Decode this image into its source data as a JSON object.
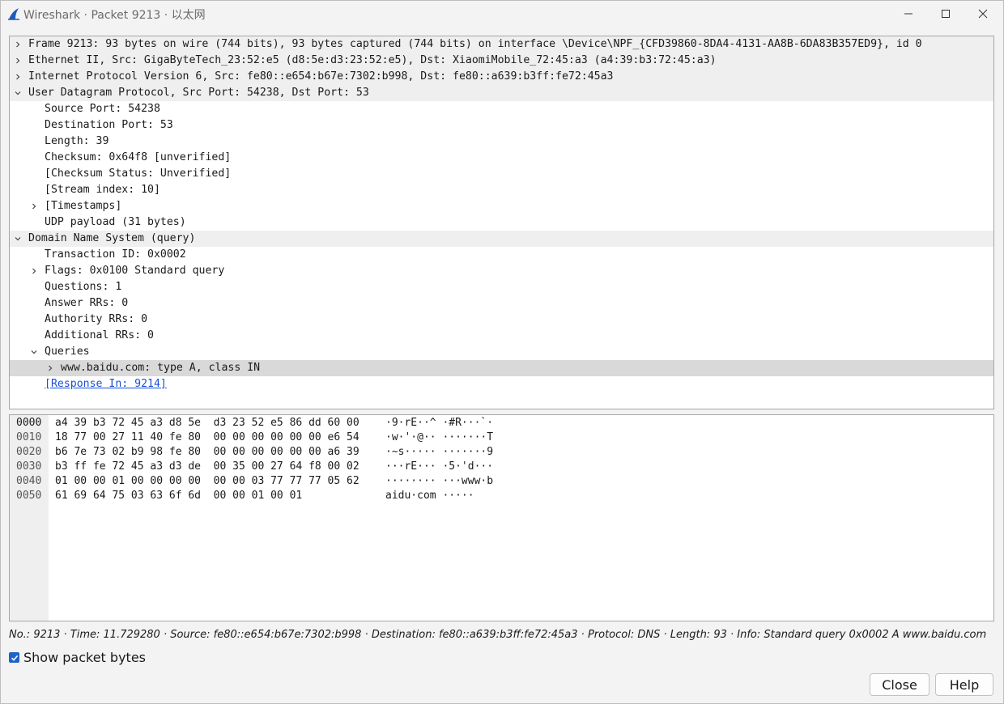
{
  "window": {
    "title": "Wireshark · Packet 9213 · 以太网"
  },
  "tree": [
    {
      "text": "Frame 9213: 93 bytes on wire (744 bits), 93 bytes captured (744 bits) on interface \\Device\\NPF_{CFD39860-8DA4-4131-AA8B-6DA83B357ED9}, id 0",
      "level": 0,
      "arrow": "right",
      "header": true
    },
    {
      "text": "Ethernet II, Src: GigaByteTech_23:52:e5 (d8:5e:d3:23:52:e5), Dst: XiaomiMobile_72:45:a3 (a4:39:b3:72:45:a3)",
      "level": 0,
      "arrow": "right",
      "header": true
    },
    {
      "text": "Internet Protocol Version 6, Src: fe80::e654:b67e:7302:b998, Dst: fe80::a639:b3ff:fe72:45a3",
      "level": 0,
      "arrow": "right",
      "header": true
    },
    {
      "text": "User Datagram Protocol, Src Port: 54238, Dst Port: 53",
      "level": 0,
      "arrow": "down",
      "header": true
    },
    {
      "text": "Source Port: 54238",
      "level": 1,
      "arrow": ""
    },
    {
      "text": "Destination Port: 53",
      "level": 1,
      "arrow": ""
    },
    {
      "text": "Length: 39",
      "level": 1,
      "arrow": ""
    },
    {
      "text": "Checksum: 0x64f8 [unverified]",
      "level": 1,
      "arrow": ""
    },
    {
      "text": "[Checksum Status: Unverified]",
      "level": 1,
      "arrow": ""
    },
    {
      "text": "[Stream index: 10]",
      "level": 1,
      "arrow": ""
    },
    {
      "text": "[Timestamps]",
      "level": 1,
      "arrow": "right"
    },
    {
      "text": "UDP payload (31 bytes)",
      "level": 1,
      "arrow": ""
    },
    {
      "text": "Domain Name System (query)",
      "level": 0,
      "arrow": "down",
      "header": true
    },
    {
      "text": "Transaction ID: 0x0002",
      "level": 1,
      "arrow": ""
    },
    {
      "text": "Flags: 0x0100 Standard query",
      "level": 1,
      "arrow": "right"
    },
    {
      "text": "Questions: 1",
      "level": 1,
      "arrow": ""
    },
    {
      "text": "Answer RRs: 0",
      "level": 1,
      "arrow": ""
    },
    {
      "text": "Authority RRs: 0",
      "level": 1,
      "arrow": ""
    },
    {
      "text": "Additional RRs: 0",
      "level": 1,
      "arrow": ""
    },
    {
      "text": "Queries",
      "level": 1,
      "arrow": "down"
    },
    {
      "text": "www.baidu.com: type A, class IN",
      "level": 2,
      "arrow": "right",
      "selected": true
    },
    {
      "text": "[Response In: 9214]",
      "level": 1,
      "arrow": "",
      "link": true
    }
  ],
  "hex": [
    {
      "offset": "0000",
      "bytes": "a4 39 b3 72 45 a3 d8 5e  d3 23 52 e5 86 dd 60 00",
      "ascii": "·9·rE··^ ·#R···`·"
    },
    {
      "offset": "0010",
      "bytes": "18 77 00 27 11 40 fe 80  00 00 00 00 00 00 e6 54",
      "ascii": "·w·'·@·· ·······T"
    },
    {
      "offset": "0020",
      "bytes": "b6 7e 73 02 b9 98 fe 80  00 00 00 00 00 00 a6 39",
      "ascii": "·~s····· ·······9"
    },
    {
      "offset": "0030",
      "bytes": "b3 ff fe 72 45 a3 d3 de  00 35 00 27 64 f8 00 02",
      "ascii": "···rE··· ·5·'d···"
    },
    {
      "offset": "0040",
      "bytes": "01 00 00 01 00 00 00 00  00 00 03 77 77 77 05 62",
      "ascii": "········ ···www·b"
    },
    {
      "offset": "0050",
      "bytes": "61 69 64 75 03 63 6f 6d  00 00 01 00 01",
      "ascii": "aidu·com ·····"
    }
  ],
  "status_line": "No.: 9213 · Time: 11.729280 · Source: fe80::e654:b67e:7302:b998 · Destination: fe80::a639:b3ff:fe72:45a3 · Protocol: DNS · Length: 93 · Info: Standard query 0x0002 A www.baidu.com",
  "show_bytes": {
    "label": "Show packet bytes",
    "checked": true
  },
  "buttons": {
    "close": "Close",
    "help": "Help"
  },
  "colors": {
    "accent": "#1f63c6",
    "link": "#1a4fd8",
    "header_bg": "#efefef",
    "selected_bg": "#d9d9d9",
    "shark_blue": "#1e5bb8"
  },
  "icons": {
    "app": "wireshark-fin-icon",
    "minimize": "minimize-icon",
    "maximize": "maximize-icon",
    "close": "close-icon",
    "expand": "chevron-right-icon",
    "collapse": "chevron-down-icon",
    "check": "checkmark-icon"
  }
}
